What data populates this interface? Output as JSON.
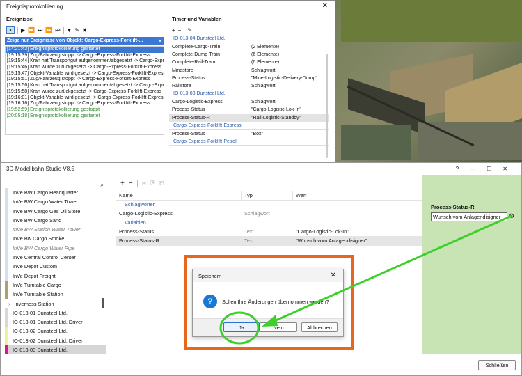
{
  "log": {
    "title": "Ereignisprotokollierung",
    "events_heading": "Ereignisse",
    "toolbar_glyphs": [
      "⏸",
      "▶",
      "⏩",
      "⏭",
      "⏩",
      "⏭",
      "▼",
      "✎",
      "✖"
    ],
    "filter_text": "Zeige nur Ereignisse von Objekt: Cargo-Express-Forklift-...",
    "filter_close": "✕",
    "lines": [
      {
        "text": "[14:21:43] Ereignisprotokollierung gestartet",
        "style": "sel"
      },
      {
        "text": "[19:15:39] Zug/Fahrzeug stoppt -> Cargo-Express-Forklift-Express",
        "style": ""
      },
      {
        "text": "[19:15:44] Kran hat Transportgut aufgenommen/abgesetzt -> Cargo-Express-Forklift-Express",
        "style": ""
      },
      {
        "text": "[19:15:46] Kran wurde zurückgesetzt -> Cargo-Express-Forklift-Express",
        "style": ""
      },
      {
        "text": "[19:15:47]     Objekt-Variable wird gesetzt -> Cargo-Express-Forklift-Express",
        "style": ""
      },
      {
        "text": "[19:15:51] Zug/Fahrzeug stoppt -> Cargo-Express-Forklift-Express",
        "style": ""
      },
      {
        "text": "[19:15:56] Kran hat Transportgut aufgenommen/abgesetzt -> Cargo-Express-Forklift-Express",
        "style": ""
      },
      {
        "text": "[19:15:58] Kran wurde zurückgesetzt -> Cargo-Express-Forklift-Express",
        "style": ""
      },
      {
        "text": "[19:16:01]     Objekt-Variable wird gesetzt -> Cargo-Express-Forklift-Express",
        "style": ""
      },
      {
        "text": "[19:16:16] Zug/Fahrzeug stoppt -> Cargo-Express-Forklift-Express",
        "style": ""
      },
      {
        "text": "[19:52:59] Ereignisprotokollierung gestoppt",
        "style": "g"
      },
      {
        "text": "[20:05:18] Ereignisprotokollierung gestartet",
        "style": "g"
      }
    ],
    "vars_heading": "Timer und Variablen",
    "vars_toolbar": [
      "+",
      "−",
      "✎"
    ],
    "groups": [
      {
        "name": "IO-013-04 Dunsteel Ltd.",
        "rows": [
          {
            "k": "Complete-Cargo-Train",
            "v": "(2 Elemente)",
            "hl": false
          },
          {
            "k": "Complete-Dump-Train",
            "v": "(6 Elemente)",
            "hl": false
          },
          {
            "k": "Complete-Rail-Train",
            "v": "(6 Elemente)",
            "hl": false
          },
          {
            "k": "Minestore",
            "v": "Schlagwort",
            "hl": false
          },
          {
            "k": "Process-Status",
            "v": "\"Mine-Logistic-Delivery-Dump\"",
            "hl": false
          },
          {
            "k": "Railstore",
            "v": "Schlagwort",
            "hl": false
          }
        ]
      },
      {
        "name": "IO-013-03 Dunsteel Ltd.",
        "rows": [
          {
            "k": "Cargo-Logistic-Express",
            "v": "Schlagwort",
            "hl": false
          },
          {
            "k": "Process-Status",
            "v": "\"Cargo-Logistic-Lok-In\"",
            "hl": false
          },
          {
            "k": "Process-Status-R",
            "v": "\"Rail-Logistic-Standby\"",
            "hl": true
          }
        ]
      },
      {
        "name": "Cargo-Express-Forklift-Express",
        "rows": [
          {
            "k": "Process-Status",
            "v": "\"Box\"",
            "hl": false
          }
        ]
      },
      {
        "name": "Cargo-Express-Forklift-Petrol",
        "rows": []
      }
    ]
  },
  "studio": {
    "title": "3D-Modellbahn Studio V8.5",
    "win_controls": [
      "?",
      "—",
      "☐",
      "✕"
    ],
    "list_items": [
      {
        "label": "InVe  BW  Cargo  Headquarter",
        "color": "#cfe0f0",
        "style": ""
      },
      {
        "label": "InVe  BW  Cargo  Water Tower",
        "color": "#cfe0f0",
        "style": ""
      },
      {
        "label": "InVe  BW  Cargo Gas Oil Store",
        "color": "#cfe0f0",
        "style": ""
      },
      {
        "label": "InVe  BW  Cargo Sand",
        "color": "#cfe0f0",
        "style": ""
      },
      {
        "label": "InVe  BW  Station  Water Tower",
        "color": "#cfe0f0",
        "style": "it"
      },
      {
        "label": "InVe  Bw Cargo Smoke",
        "color": "#cfe0f0",
        "style": ""
      },
      {
        "label": "InVe  BW Cargo Water Pipe",
        "color": "#cfe0f0",
        "style": "it"
      },
      {
        "label": "InVe  Central Control Center",
        "color": "#cfe0f0",
        "style": ""
      },
      {
        "label": "InVe  Depot Custom",
        "color": "#cfe0f0",
        "style": ""
      },
      {
        "label": "InVe  Depot Freight",
        "color": "#cfe0f0",
        "style": ""
      },
      {
        "label": "InVe  Turntable  Cargo",
        "color": "#a8a26e",
        "style": ""
      },
      {
        "label": "InVe  Turntable  Station",
        "color": "#a8a26e",
        "style": ""
      },
      {
        "label": "Inverness Station",
        "color": "#ffffff",
        "style": "arrow"
      },
      {
        "label": "IO-013-01 Dunsteel Ltd.",
        "color": "#d8d8d8",
        "style": ""
      },
      {
        "label": "IO-013-01 Dunsteel Ltd. Driver",
        "color": "#d8d8d8",
        "style": ""
      },
      {
        "label": "IO-013-02 Dunsteel Ltd.",
        "color": "#f2ee9a",
        "style": ""
      },
      {
        "label": "IO-013-02 Dunsteel Ltd. Driver",
        "color": "#f2ee9a",
        "style": ""
      },
      {
        "label": "IO-013-03 Dunsteel Ltd.",
        "color": "#d6188c",
        "style": "sel"
      }
    ],
    "list_search": "⌕",
    "toolbar": [
      "+",
      "−",
      "✂",
      "⎘",
      "⎗"
    ],
    "columns": {
      "name": "Name",
      "type": "Typ",
      "value": "Wert"
    },
    "sections": [
      {
        "name": "Schlagwörter",
        "rows": [
          {
            "name": "Cargo-Logistic-Express",
            "type": "Schlagwort",
            "value": "",
            "hl": false
          }
        ]
      },
      {
        "name": "Variablen",
        "rows": [
          {
            "name": "Process-Status",
            "type": "Text",
            "value": "\"Cargo-Logistic-Lok-In\"",
            "hl": false
          },
          {
            "name": "Process-Status-R",
            "type": "Text",
            "value": "\"Wunsch vom Anlagendisigner\"",
            "hl": true
          }
        ]
      }
    ],
    "property": {
      "title": "Process-Status-R",
      "value": "Wunsch vom Anlagendisigner",
      "gear": "⚙"
    },
    "close_button": "Schließen"
  },
  "dialog": {
    "title": "Speichern",
    "close": "✕",
    "icon": "?",
    "message": "Sollen Ihre Änderungen übernommen werden?",
    "buttons": {
      "yes": "Ja",
      "no": "Nein",
      "cancel": "Abbrechen"
    }
  },
  "colors": {
    "accent": "#3b78d6",
    "orange_frame": "#e8671e",
    "annotation_green": "#3ecf2c",
    "panel_green": "#c9e4b4"
  }
}
